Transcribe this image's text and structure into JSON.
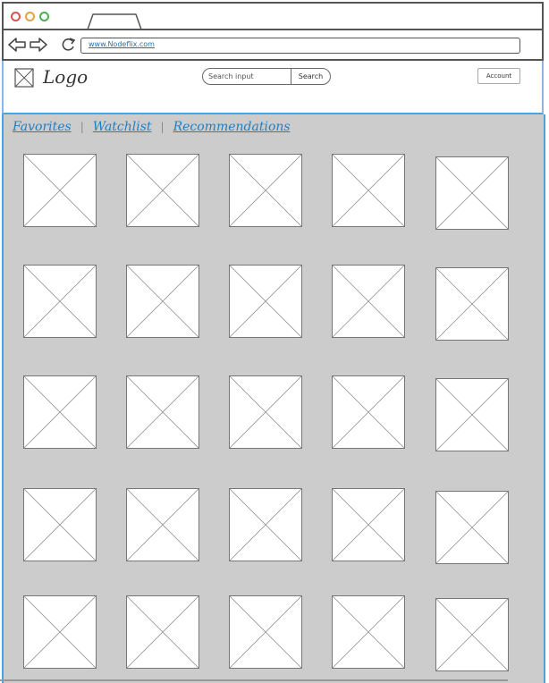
{
  "browser": {
    "url": "www.Nodeflix.com",
    "window_dots": [
      "#d9534f",
      "#e6a23c",
      "#4caf50"
    ]
  },
  "header": {
    "logo_text": "Logo",
    "search": {
      "placeholder": "Search input",
      "button_label": "Search"
    },
    "account_label": "Account"
  },
  "tabs": [
    {
      "label": "Favorites"
    },
    {
      "label": "Watchlist"
    },
    {
      "label": "Recommendations"
    }
  ],
  "grid": {
    "rows": 5,
    "columns": 5
  },
  "colors": {
    "accent": "#1f7fc4",
    "content_bg": "#cccccc",
    "frame_border": "#4aa3df"
  }
}
